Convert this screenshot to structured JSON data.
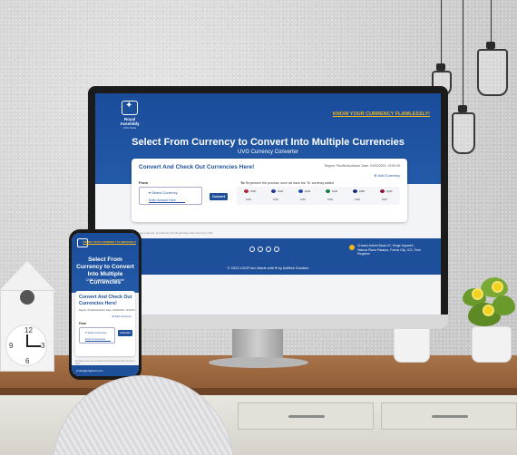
{
  "website": {
    "hero_link": "KNOW YOUR CURRENCY FLAWLESSLY!",
    "title": "Select From Currency to Convert Into Multiple Currencies",
    "subtitle": "UVG Currency Converter",
    "card_title": "Convert And Check Out Currencies Here!",
    "card_meta": "Region: Pacific/Auckland, Date: 24/02/2023, 10:52:09",
    "add_currency": "Add Currency",
    "from_label": "From",
    "select_currency": "Select Currency",
    "amount_placeholder": "Enter Amount Here",
    "convert_button": "Convert",
    "to_label": "To",
    "to_note": "Re-perform the process, once we have the 'To' currency added",
    "rates": [
      {
        "code": "USD",
        "value": "0.00",
        "flag_color": "#b22234"
      },
      {
        "code": "AUD",
        "value": "0.00",
        "flag_color": "#1f3a93"
      },
      {
        "code": "EUR",
        "value": "0.00",
        "flag_color": "#1f4aa8"
      },
      {
        "code": "ZAR",
        "value": "0.00",
        "flag_color": "#0b7a3b"
      },
      {
        "code": "GBP",
        "value": "0.00",
        "flag_color": "#1a2f7a"
      },
      {
        "code": "QAR",
        "value": "0.00",
        "flag_color": "#8a1538"
      }
    ],
    "disclaimer": "Exchange rates are provided by the Royal Assembly Currency UVG",
    "footer_link": "...com",
    "address": "Crowns Admin Block #7, Kings Square1, Halona Plaza Palazzo, Forms City, ICS, Twin Kingdom",
    "copyright": "© 2023 UVGForm Made with ♥ by AdWeb Solution"
  },
  "phone": {
    "hero_link": "KNOW YOUR CURRENCY FLAWLESSLY!",
    "title": "Select From Currency to Convert Into Multiple Currencies",
    "subtitle": "UVG Currency Converter",
    "card_title": "Convert And Check Out Currencies Here!",
    "card_meta": "Region: Pacific/Auckland, Date: 24/02/2023, 10:52:09",
    "add_currency": "Add Currency",
    "from_label": "From",
    "select_currency": "Select Currency",
    "amount_placeholder": "Enter Amount Here",
    "convert_button": "Convert",
    "disclaimer": "Exchange rates are provided by the Royal Assembly Currency UVG",
    "email": "contact@uvgforms.com"
  },
  "colors": {
    "brand_blue": "#1d4f9b",
    "accent_gold": "#f3b71b"
  }
}
